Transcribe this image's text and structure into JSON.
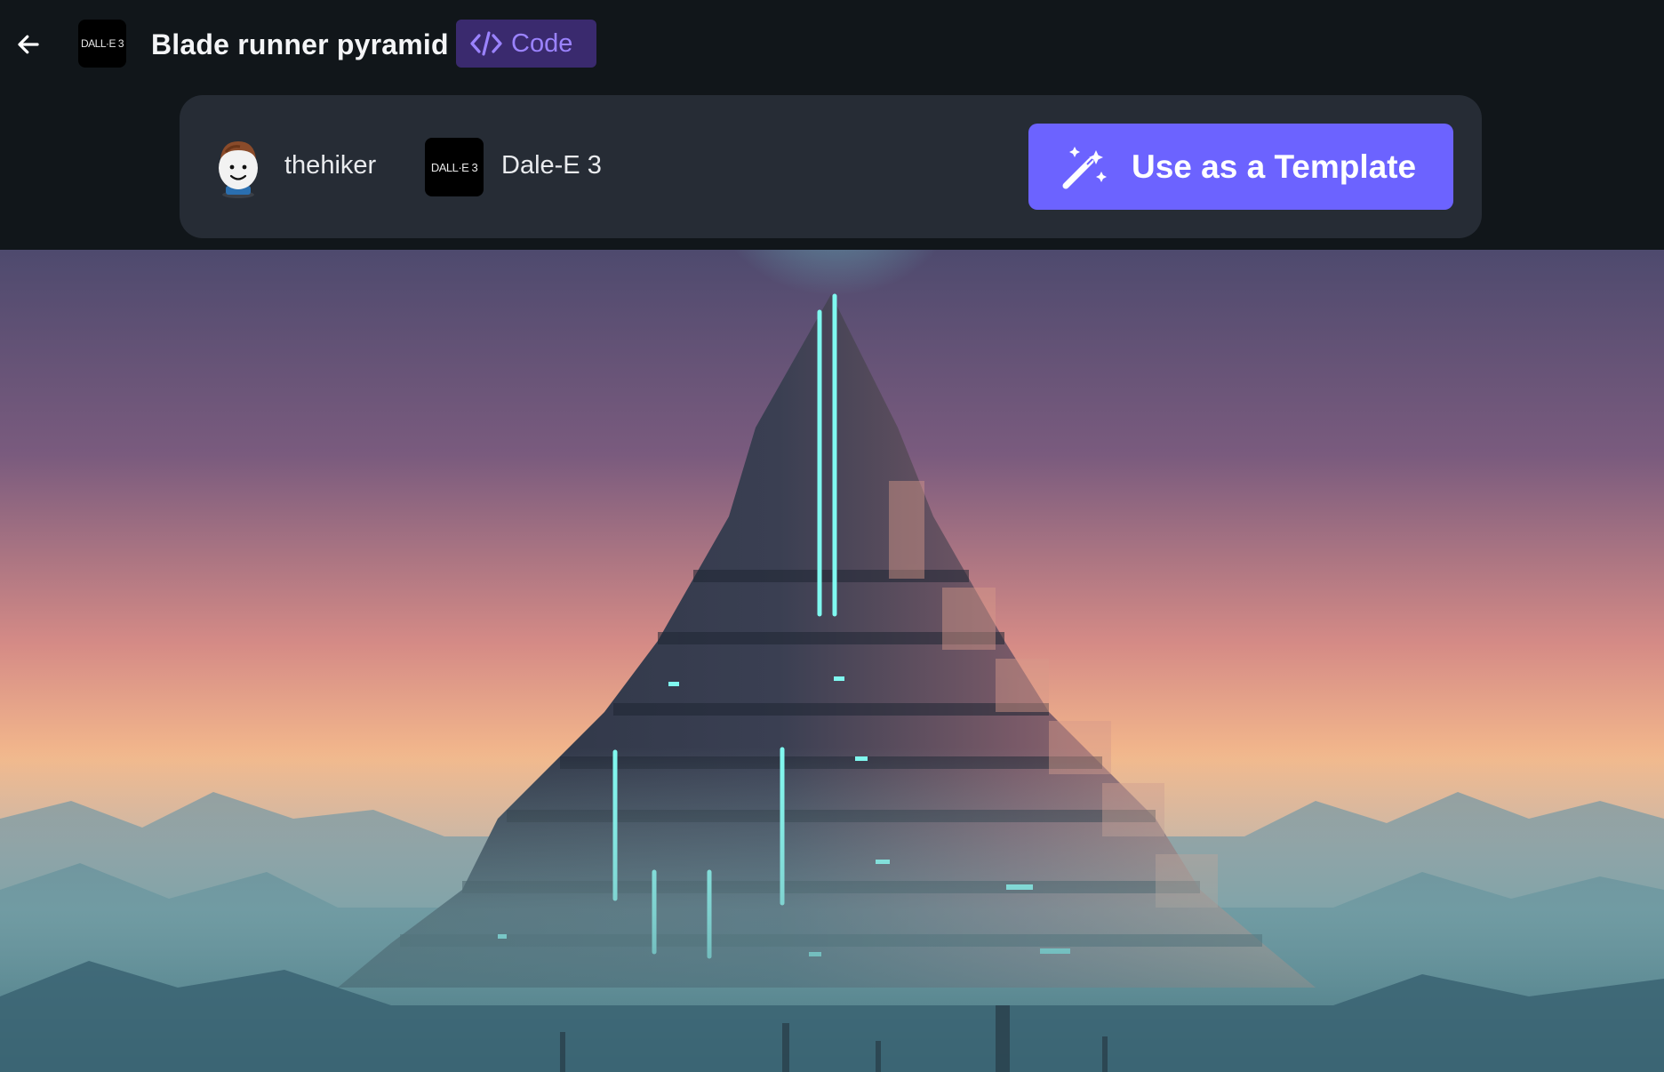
{
  "header": {
    "back_icon": "arrow-left-icon",
    "model_thumb_text": "DALL·E 3",
    "title": "Blade runner pyramid",
    "code_badge": {
      "icon": "code-icon",
      "label": "Code"
    }
  },
  "info_panel": {
    "author": {
      "avatar_icon": "robot-avatar",
      "name": "thehiker"
    },
    "model": {
      "thumb_text": "DALL·E 3",
      "name": "Dale-E 3"
    },
    "template_button": {
      "icon": "magic-wand-icon",
      "label": "Use as a Template"
    }
  },
  "colors": {
    "background": "#11161a",
    "panel": "#262c35",
    "accent": "#6c63ff",
    "code_badge_bg": "#3a2a6e",
    "code_badge_fg": "#9b83ff",
    "neon": "#5ef2e8"
  },
  "image": {
    "subject": "futuristic stepped pyramid with neon light strips over misty mountains at dusk"
  }
}
